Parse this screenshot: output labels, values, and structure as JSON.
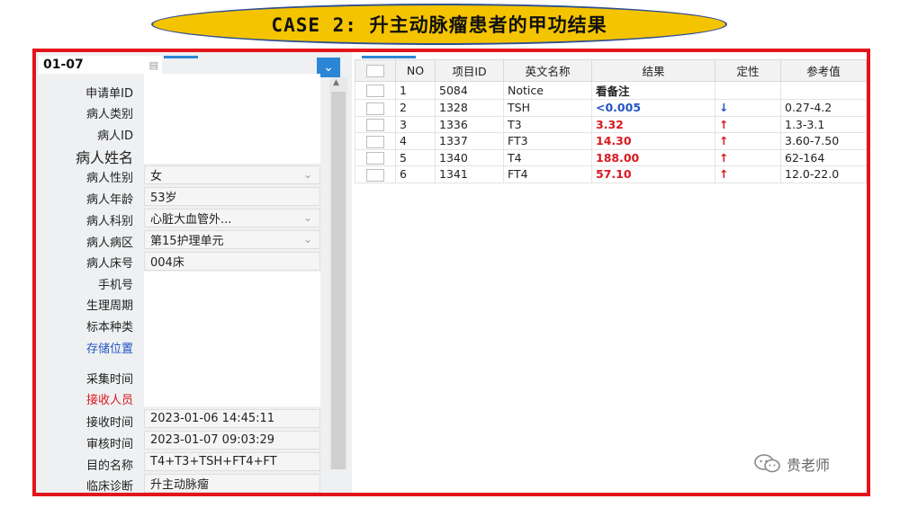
{
  "banner": {
    "title": "CASE 2:  升主动脉瘤患者的甲功结果"
  },
  "left": {
    "date": "01-07",
    "labels": [
      "申请单ID",
      "病人类别",
      "病人ID",
      "病人姓名",
      "病人性别",
      "病人年龄",
      "病人科别",
      "病人病区",
      "病人床号",
      "手机号",
      "生理周期",
      "标本种类",
      "存储位置",
      "采集时间",
      "接收人员",
      "接收时间",
      "审核时间",
      "目的名称",
      "临床诊断"
    ],
    "fields": {
      "sex": "女",
      "age": "53岁",
      "dept": "心脏大血管外...",
      "ward": "第15护理单元",
      "bed": "004床",
      "receive_time": "2023-01-06 14:45:11",
      "review_time": "2023-01-07 09:03:29",
      "purpose": "T4+T3+TSH+FT4+FT",
      "diagnosis": "升主动脉瘤"
    }
  },
  "table": {
    "headers": [
      "NO",
      "项目ID",
      "英文名称",
      "结果",
      "定性",
      "参考值"
    ],
    "rows": [
      {
        "no": "1",
        "id": "5084",
        "name": "Notice",
        "result": "看备注",
        "flag": "",
        "ref": ""
      },
      {
        "no": "2",
        "id": "1328",
        "name": "TSH",
        "result": "<0.005",
        "flag": "↓",
        "ref": "0.27-4.2"
      },
      {
        "no": "3",
        "id": "1336",
        "name": "T3",
        "result": "3.32",
        "flag": "↑",
        "ref": "1.3-3.1"
      },
      {
        "no": "4",
        "id": "1337",
        "name": "FT3",
        "result": "14.30",
        "flag": "↑",
        "ref": "3.60-7.50"
      },
      {
        "no": "5",
        "id": "1340",
        "name": "T4",
        "result": "188.00",
        "flag": "↑",
        "ref": "62-164"
      },
      {
        "no": "6",
        "id": "1341",
        "name": "FT4",
        "result": "57.10",
        "flag": "↑",
        "ref": "12.0-22.0"
      }
    ]
  },
  "watermark": {
    "text": "贵老师"
  }
}
